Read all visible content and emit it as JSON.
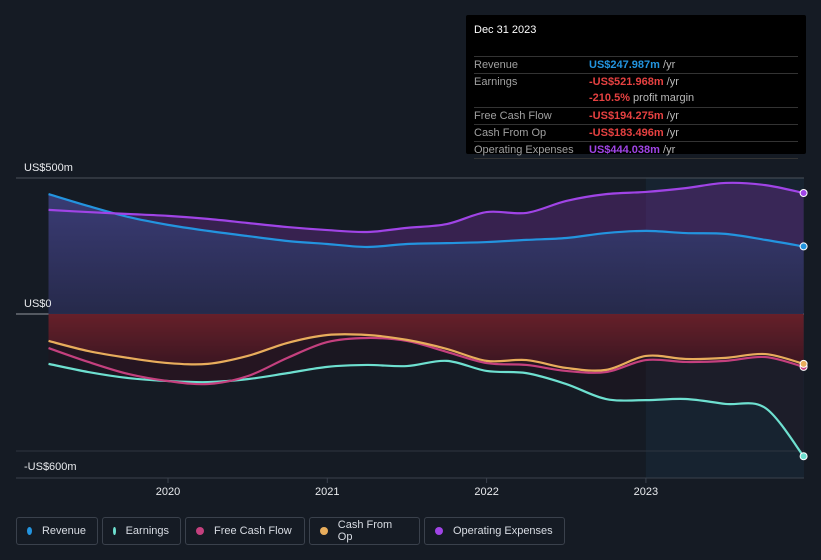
{
  "tooltip": {
    "date": "Dec 31 2023",
    "rows": [
      {
        "label": "Revenue",
        "value": "US$247.987m",
        "suffix": " /yr",
        "color": "#2394df"
      },
      {
        "label": "Earnings",
        "value": "-US$521.968m",
        "suffix": " /yr",
        "color": "#e64141"
      },
      {
        "label": "",
        "value": "-210.5%",
        "suffix": " profit margin",
        "color": "#e64141"
      },
      {
        "label": "Free Cash Flow",
        "value": "-US$194.275m",
        "suffix": " /yr",
        "color": "#e64141"
      },
      {
        "label": "Cash From Op",
        "value": "-US$183.496m",
        "suffix": " /yr",
        "color": "#e64141"
      },
      {
        "label": "Operating Expenses",
        "value": "US$444.038m",
        "suffix": " /yr",
        "color": "#a044e6"
      }
    ]
  },
  "legend": [
    {
      "label": "Revenue",
      "color": "#2394df"
    },
    {
      "label": "Earnings",
      "color": "#6ee0d0"
    },
    {
      "label": "Free Cash Flow",
      "color": "#c4407e"
    },
    {
      "label": "Cash From Op",
      "color": "#e8ad5c"
    },
    {
      "label": "Operating Expenses",
      "color": "#a044e6"
    }
  ],
  "chart_data": {
    "type": "area",
    "title": "",
    "ylabel": "",
    "xlabel": "",
    "unit": "US$ millions",
    "ylim": [
      -600,
      500
    ],
    "y_tick_labels": [
      "US$500m",
      "US$0",
      "-US$600m"
    ],
    "x_tick_labels": [
      "2020",
      "2021",
      "2022",
      "2023"
    ],
    "x": [
      2019.25,
      2019.5,
      2019.75,
      2020.0,
      2020.25,
      2020.5,
      2020.75,
      2021.0,
      2021.25,
      2021.5,
      2021.75,
      2022.0,
      2022.25,
      2022.5,
      2022.75,
      2023.0,
      2023.25,
      2023.5,
      2023.75,
      2023.99
    ],
    "series": [
      {
        "name": "Revenue",
        "color": "#2394df",
        "values": [
          440,
          396,
          356,
          327,
          305,
          286,
          268,
          257,
          246,
          257,
          260,
          264,
          272,
          279,
          297,
          305,
          297,
          294,
          272,
          248
        ]
      },
      {
        "name": "Earnings",
        "color": "#6ee0d0",
        "values": [
          -183,
          -213,
          -235,
          -246,
          -250,
          -239,
          -217,
          -194,
          -187,
          -191,
          -172,
          -209,
          -217,
          -257,
          -312,
          -316,
          -312,
          -330,
          -345,
          -522
        ]
      },
      {
        "name": "Free Cash Flow",
        "color": "#c4407e",
        "values": [
          -125,
          -176,
          -220,
          -246,
          -257,
          -228,
          -161,
          -103,
          -88,
          -99,
          -139,
          -180,
          -187,
          -209,
          -213,
          -169,
          -176,
          -172,
          -158,
          -194
        ]
      },
      {
        "name": "Cash From Op",
        "color": "#e8ad5c",
        "values": [
          -99,
          -136,
          -161,
          -180,
          -183,
          -154,
          -106,
          -77,
          -77,
          -95,
          -128,
          -172,
          -169,
          -198,
          -205,
          -154,
          -165,
          -161,
          -147,
          -183
        ]
      },
      {
        "name": "Operating Expenses",
        "color": "#a044e6",
        "values": [
          382,
          374,
          367,
          360,
          349,
          334,
          319,
          308,
          301,
          316,
          330,
          374,
          371,
          415,
          440,
          448,
          462,
          481,
          473,
          444
        ]
      }
    ],
    "highlight_start": 2023.0,
    "grid": true,
    "legend_position": "bottom-left"
  }
}
